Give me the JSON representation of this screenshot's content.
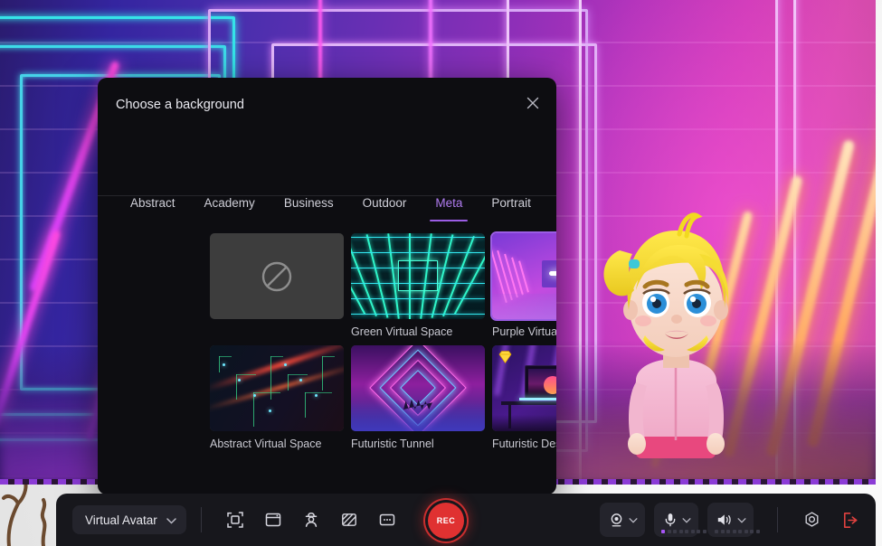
{
  "dialog": {
    "title": "Choose a background",
    "close_icon": "close-icon",
    "tabs": [
      {
        "label": "Abstract",
        "active": false
      },
      {
        "label": "Academy",
        "active": false
      },
      {
        "label": "Business",
        "active": false
      },
      {
        "label": "Outdoor",
        "active": false
      },
      {
        "label": "Meta",
        "active": true
      },
      {
        "label": "Portrait",
        "active": false
      }
    ],
    "accent_color": "#9b5de5",
    "backgrounds": [
      {
        "label": "",
        "kind": "none",
        "selected": false,
        "premium": false
      },
      {
        "label": "Green Virtual Space",
        "kind": "green-virtual-space",
        "selected": false,
        "premium": false
      },
      {
        "label": "Purple Virtual Space",
        "kind": "purple-virtual-space",
        "selected": true,
        "premium": false
      },
      {
        "label": "Abstract Virtual Space",
        "kind": "abstract-virtual-space",
        "selected": false,
        "premium": false
      },
      {
        "label": "Futuristic Tunnel",
        "kind": "futuristic-tunnel",
        "selected": false,
        "premium": false
      },
      {
        "label": "Futuristic Desktop Desk",
        "kind": "futuristic-desktop-desk",
        "selected": false,
        "premium": true
      }
    ]
  },
  "toolbar": {
    "source_select": {
      "value": "Virtual Avatar",
      "chevron_icon": "chevron-down-icon"
    },
    "tools": [
      {
        "name": "screen-capture-region-icon"
      },
      {
        "name": "window-capture-icon"
      },
      {
        "name": "avatar-icon"
      },
      {
        "name": "background-icon"
      },
      {
        "name": "captions-icon"
      }
    ],
    "record": {
      "label": "REC",
      "color": "#e03131"
    },
    "camera": {
      "icon": "webcam-icon",
      "chevron_icon": "chevron-down-icon"
    },
    "microphone": {
      "icon": "microphone-icon",
      "chevron_icon": "chevron-down-icon",
      "level": 1,
      "level_max": 8,
      "level_color": "#a855f7"
    },
    "speaker": {
      "icon": "speaker-icon",
      "chevron_icon": "chevron-down-icon",
      "level": 0,
      "level_max": 8
    },
    "settings": {
      "icon": "gear-icon"
    },
    "exit": {
      "icon": "exit-icon",
      "color": "#e0413f"
    }
  },
  "stage": {
    "background_name": "Purple Virtual Space",
    "avatar_name": "blonde-girl-avatar"
  }
}
